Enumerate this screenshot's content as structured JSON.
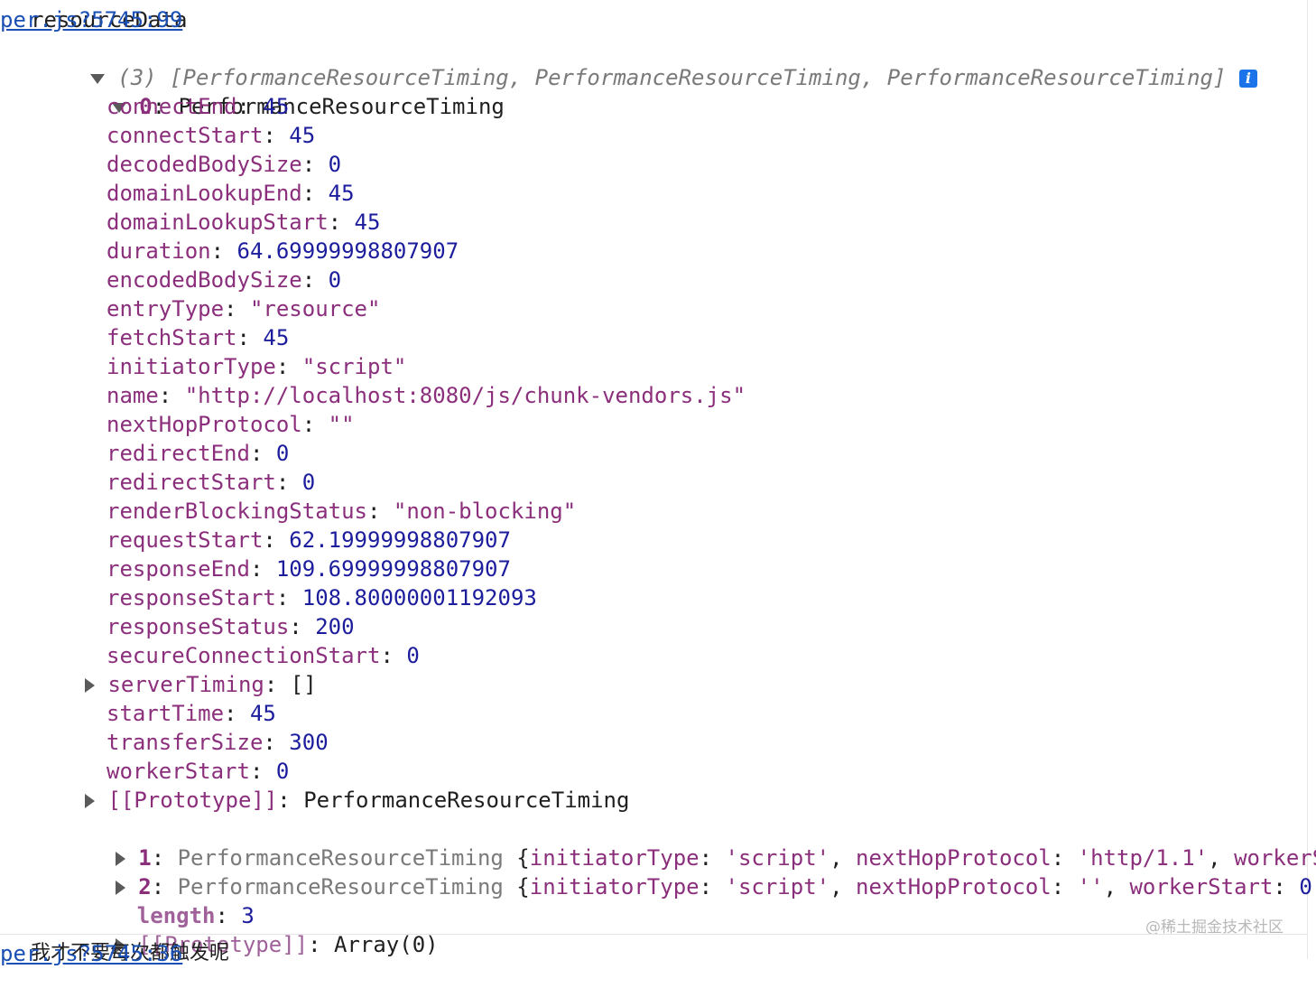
{
  "log1": {
    "label": "resourceData",
    "source": "per.js?5745:99",
    "array_summary": "(3) [PerformanceResourceTiming, PerformanceResourceTiming, PerformanceResourceTiming]",
    "item0": {
      "index": "0",
      "type": "PerformanceResourceTiming",
      "props": [
        {
          "key": "connectEnd",
          "value": "45",
          "kind": "num"
        },
        {
          "key": "connectStart",
          "value": "45",
          "kind": "num"
        },
        {
          "key": "decodedBodySize",
          "value": "0",
          "kind": "num"
        },
        {
          "key": "domainLookupEnd",
          "value": "45",
          "kind": "num"
        },
        {
          "key": "domainLookupStart",
          "value": "45",
          "kind": "num"
        },
        {
          "key": "duration",
          "value": "64.69999998807907",
          "kind": "num"
        },
        {
          "key": "encodedBodySize",
          "value": "0",
          "kind": "num"
        },
        {
          "key": "entryType",
          "value": "\"resource\"",
          "kind": "str"
        },
        {
          "key": "fetchStart",
          "value": "45",
          "kind": "num"
        },
        {
          "key": "initiatorType",
          "value": "\"script\"",
          "kind": "str"
        },
        {
          "key": "name",
          "value": "\"http://localhost:8080/js/chunk-vendors.js\"",
          "kind": "str"
        },
        {
          "key": "nextHopProtocol",
          "value": "\"\"",
          "kind": "str"
        },
        {
          "key": "redirectEnd",
          "value": "0",
          "kind": "num"
        },
        {
          "key": "redirectStart",
          "value": "0",
          "kind": "num"
        },
        {
          "key": "renderBlockingStatus",
          "value": "\"non-blocking\"",
          "kind": "str"
        },
        {
          "key": "requestStart",
          "value": "62.19999998807907",
          "kind": "num"
        },
        {
          "key": "responseEnd",
          "value": "109.69999998807907",
          "kind": "num"
        },
        {
          "key": "responseStart",
          "value": "108.80000001192093",
          "kind": "num"
        },
        {
          "key": "responseStatus",
          "value": "200",
          "kind": "num"
        },
        {
          "key": "secureConnectionStart",
          "value": "0",
          "kind": "num"
        },
        {
          "key": "serverTiming",
          "value": "[]",
          "kind": "obj",
          "expandable": true
        },
        {
          "key": "startTime",
          "value": "45",
          "kind": "num"
        },
        {
          "key": "transferSize",
          "value": "300",
          "kind": "num"
        },
        {
          "key": "workerStart",
          "value": "0",
          "kind": "num"
        },
        {
          "key": "[[Prototype]]",
          "value": "PerformanceResourceTiming",
          "kind": "obj",
          "expandable": true
        }
      ]
    },
    "item1": {
      "index": "1",
      "type": "PerformanceResourceTiming",
      "preview_k1": "initiatorType",
      "preview_v1": "'script'",
      "preview_k2": "nextHopProtocol",
      "preview_v2": "'http/1.1'",
      "preview_k3": "workerSta"
    },
    "item2": {
      "index": "2",
      "type": "PerformanceResourceTiming",
      "preview_k1": "initiatorType",
      "preview_v1": "'script'",
      "preview_k2": "nextHopProtocol",
      "preview_v2": "''",
      "preview_k3": "workerStart",
      "preview_v3": "0",
      "preview_tail": "r"
    },
    "length_key": "length",
    "length_value": "3",
    "proto_key": "[[Prototype]]",
    "proto_value": "Array(0)"
  },
  "log2": {
    "text": "我才不要每次都触发呢",
    "source": "per.js?5745:36"
  },
  "watermark": "@稀土掘金技术社区",
  "colors": {
    "key": "#8b2f7c",
    "number": "#1c1d9c",
    "link": "#1a4fb4",
    "info": "#1a73e8"
  },
  "icons": [
    "disclosure-triangle-icon",
    "info-icon"
  ]
}
